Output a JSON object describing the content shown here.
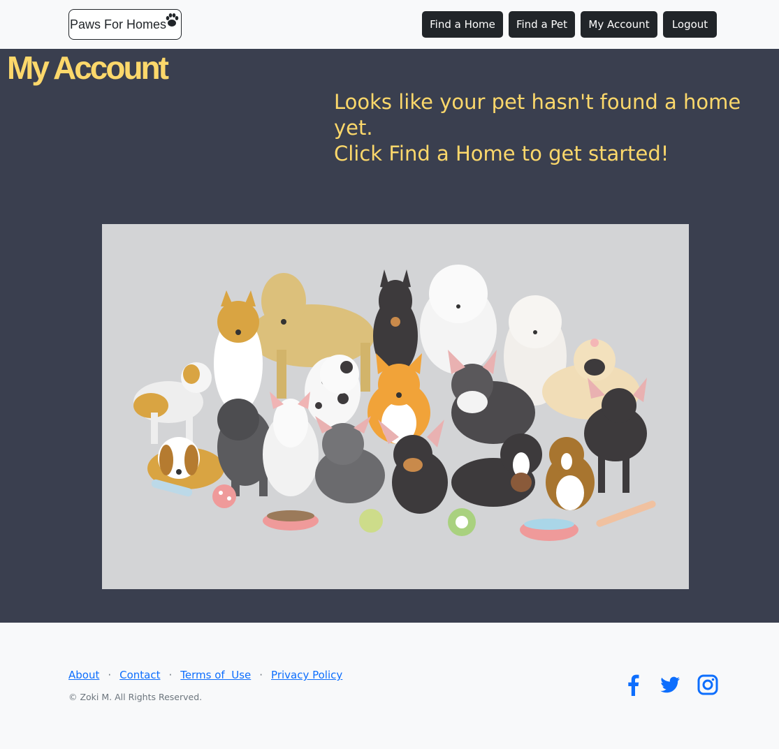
{
  "header": {
    "brand": "Paws For Homes",
    "nav": [
      "Find a Home",
      "Find a Pet",
      "My Account",
      "Logout"
    ]
  },
  "main": {
    "title": "My Account",
    "message_line1": "Looks like your pet hasn't found a home yet.",
    "message_line2": "Click Find a Home to get started!"
  },
  "footer": {
    "links": [
      "About",
      "Contact",
      "Terms of  Use",
      "Privacy Policy"
    ],
    "separator": "·",
    "copyright": "© Zoki M. All Rights Reserved.",
    "social_icons": [
      "facebook-icon",
      "twitter-icon",
      "instagram-icon"
    ]
  },
  "colors": {
    "navbar_bg": "#f8f9fa",
    "main_bg": "#3a3f4f",
    "accent_yellow": "#fcd86b",
    "button_dark": "#212529",
    "link_blue": "#0d6efd"
  }
}
